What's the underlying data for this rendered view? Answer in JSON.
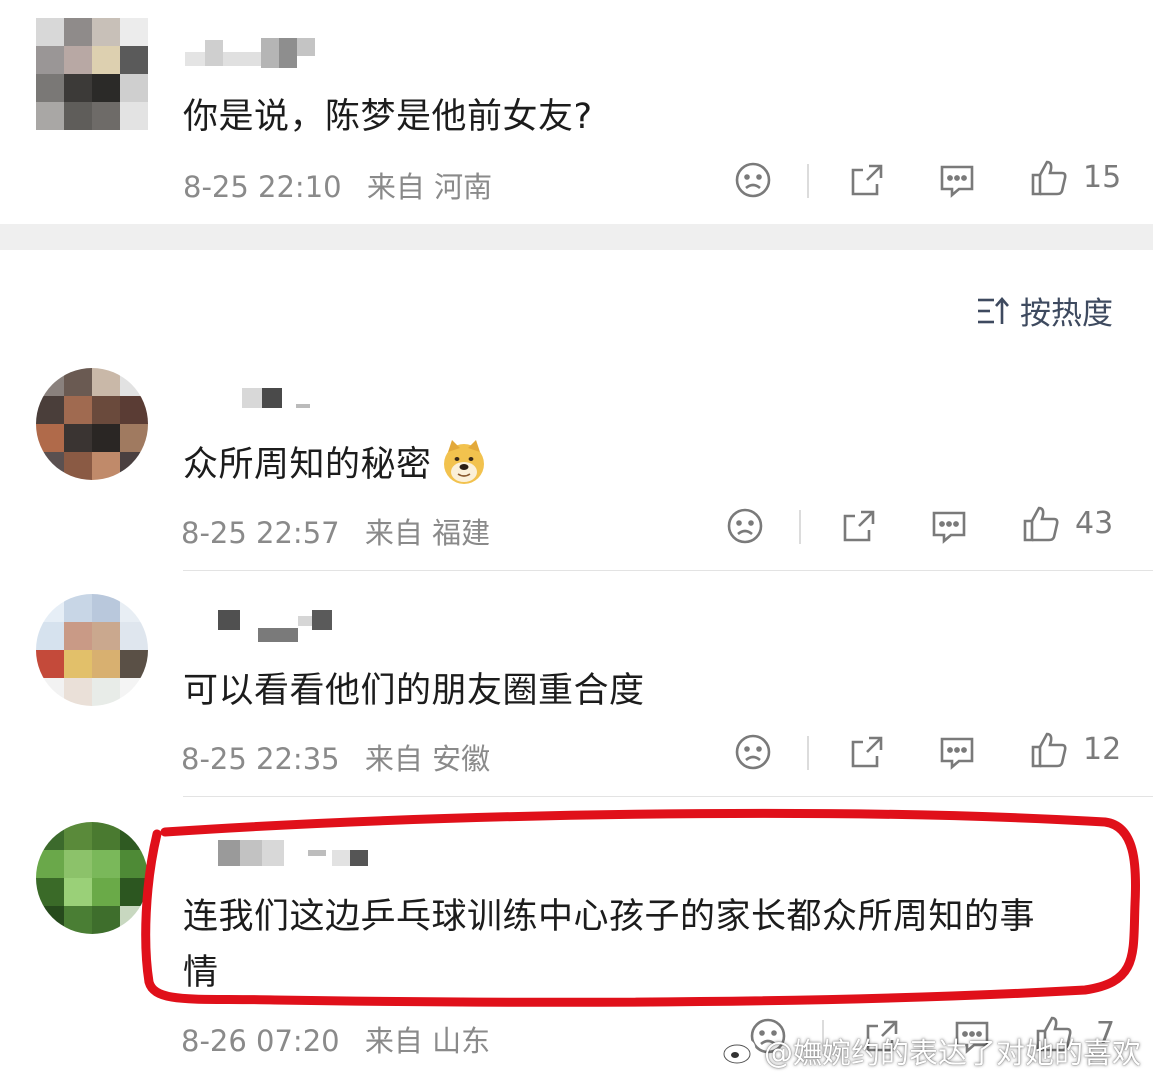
{
  "colors": {
    "text": "#1c1c1c",
    "meta": "#8a8a8a",
    "icon": "#7a7a7a",
    "separator_bar": "#efefef",
    "highlight_circle": "#e0101a",
    "sort_text": "#3e4a5f"
  },
  "top_comment": {
    "text": "你是说，陈梦是他前女友?",
    "time": "8-25 22:10",
    "source": "来自",
    "location": "河南",
    "likes": "15"
  },
  "sort": {
    "icon": "sort-icon",
    "label": "按热度"
  },
  "comments": [
    {
      "text": "众所周知的秘密",
      "emoji": "doge-emoji",
      "time": "8-25 22:57",
      "source": "来自",
      "location": "福建",
      "likes": "43"
    },
    {
      "text": "可以看看他们的朋友圈重合度",
      "time": "8-25 22:35",
      "source": "来自",
      "location": "安徽",
      "likes": "12"
    },
    {
      "text_line1": "连我们这边乒乓球训练中心孩子的家长都众所周知的事",
      "text_line2": "情",
      "time": "8-26 07:20",
      "source": "来自",
      "location": "山东",
      "likes": "7"
    }
  ],
  "action_icons": [
    "dislike-icon",
    "share-icon",
    "reply-icon",
    "like-icon"
  ],
  "watermark": {
    "text": "@嫵婉约的表达了对她的喜欢",
    "icon": "weibo-logo-icon"
  }
}
